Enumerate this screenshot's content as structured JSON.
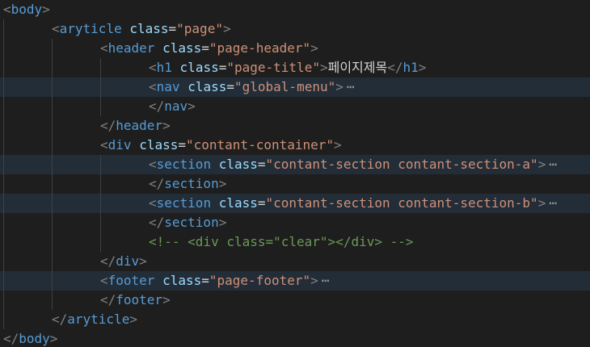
{
  "editor": {
    "lines": [
      {
        "indent": 0,
        "folded": false,
        "tokens": [
          {
            "t": "bracket",
            "v": "<"
          },
          {
            "t": "tag",
            "v": "body"
          },
          {
            "t": "bracket",
            "v": ">"
          }
        ]
      },
      {
        "indent": 1,
        "folded": false,
        "tokens": [
          {
            "t": "bracket",
            "v": "<"
          },
          {
            "t": "tag",
            "v": "aryticle"
          },
          {
            "t": "text",
            "v": " "
          },
          {
            "t": "attr",
            "v": "class"
          },
          {
            "t": "eq",
            "v": "="
          },
          {
            "t": "str",
            "v": "\"page\""
          },
          {
            "t": "bracket",
            "v": ">"
          }
        ]
      },
      {
        "indent": 2,
        "folded": false,
        "tokens": [
          {
            "t": "bracket",
            "v": "<"
          },
          {
            "t": "tag",
            "v": "header"
          },
          {
            "t": "text",
            "v": " "
          },
          {
            "t": "attr",
            "v": "class"
          },
          {
            "t": "eq",
            "v": "="
          },
          {
            "t": "str",
            "v": "\"page-header\""
          },
          {
            "t": "bracket",
            "v": ">"
          }
        ]
      },
      {
        "indent": 3,
        "folded": false,
        "tokens": [
          {
            "t": "bracket",
            "v": "<"
          },
          {
            "t": "tag",
            "v": "h1"
          },
          {
            "t": "text",
            "v": " "
          },
          {
            "t": "attr",
            "v": "class"
          },
          {
            "t": "eq",
            "v": "="
          },
          {
            "t": "str",
            "v": "\"page-title\""
          },
          {
            "t": "bracket",
            "v": ">"
          },
          {
            "t": "text",
            "v": "페이지제목"
          },
          {
            "t": "bracket",
            "v": "</"
          },
          {
            "t": "tag",
            "v": "h1"
          },
          {
            "t": "bracket",
            "v": ">"
          }
        ]
      },
      {
        "indent": 3,
        "folded": true,
        "tokens": [
          {
            "t": "bracket",
            "v": "<"
          },
          {
            "t": "tag",
            "v": "nav"
          },
          {
            "t": "text",
            "v": " "
          },
          {
            "t": "attr",
            "v": "class"
          },
          {
            "t": "eq",
            "v": "="
          },
          {
            "t": "str",
            "v": "\"global-menu\""
          },
          {
            "t": "bracket",
            "v": ">"
          },
          {
            "t": "ellipsis",
            "v": "⋯"
          }
        ]
      },
      {
        "indent": 3,
        "folded": false,
        "tokens": [
          {
            "t": "bracket",
            "v": "</"
          },
          {
            "t": "tag",
            "v": "nav"
          },
          {
            "t": "bracket",
            "v": ">"
          }
        ]
      },
      {
        "indent": 2,
        "folded": false,
        "tokens": [
          {
            "t": "bracket",
            "v": "</"
          },
          {
            "t": "tag",
            "v": "header"
          },
          {
            "t": "bracket",
            "v": ">"
          }
        ]
      },
      {
        "indent": 2,
        "folded": false,
        "tokens": [
          {
            "t": "bracket",
            "v": "<"
          },
          {
            "t": "tag",
            "v": "div"
          },
          {
            "t": "text",
            "v": " "
          },
          {
            "t": "attr",
            "v": "class"
          },
          {
            "t": "eq",
            "v": "="
          },
          {
            "t": "str",
            "v": "\"contant-container\""
          },
          {
            "t": "bracket",
            "v": ">"
          }
        ]
      },
      {
        "indent": 3,
        "folded": true,
        "tokens": [
          {
            "t": "bracket",
            "v": "<"
          },
          {
            "t": "tag",
            "v": "section"
          },
          {
            "t": "text",
            "v": " "
          },
          {
            "t": "attr",
            "v": "class"
          },
          {
            "t": "eq",
            "v": "="
          },
          {
            "t": "str",
            "v": "\"contant-section contant-section-a\""
          },
          {
            "t": "bracket",
            "v": ">"
          },
          {
            "t": "ellipsis",
            "v": "⋯"
          }
        ]
      },
      {
        "indent": 3,
        "folded": false,
        "tokens": [
          {
            "t": "bracket",
            "v": "</"
          },
          {
            "t": "tag",
            "v": "section"
          },
          {
            "t": "bracket",
            "v": ">"
          }
        ]
      },
      {
        "indent": 3,
        "folded": true,
        "tokens": [
          {
            "t": "bracket",
            "v": "<"
          },
          {
            "t": "tag",
            "v": "section"
          },
          {
            "t": "text",
            "v": " "
          },
          {
            "t": "attr",
            "v": "class"
          },
          {
            "t": "eq",
            "v": "="
          },
          {
            "t": "str",
            "v": "\"contant-section contant-section-b\""
          },
          {
            "t": "bracket",
            "v": ">"
          },
          {
            "t": "ellipsis",
            "v": "⋯"
          }
        ]
      },
      {
        "indent": 3,
        "folded": false,
        "tokens": [
          {
            "t": "bracket",
            "v": "</"
          },
          {
            "t": "tag",
            "v": "section"
          },
          {
            "t": "bracket",
            "v": ">"
          }
        ]
      },
      {
        "indent": 3,
        "folded": false,
        "tokens": [
          {
            "t": "comment",
            "v": "<!-- <div class=\"clear\"></div> -->"
          }
        ]
      },
      {
        "indent": 2,
        "folded": false,
        "tokens": [
          {
            "t": "bracket",
            "v": "</"
          },
          {
            "t": "tag",
            "v": "div"
          },
          {
            "t": "bracket",
            "v": ">"
          }
        ]
      },
      {
        "indent": 2,
        "folded": true,
        "tokens": [
          {
            "t": "bracket",
            "v": "<"
          },
          {
            "t": "tag",
            "v": "footer"
          },
          {
            "t": "text",
            "v": " "
          },
          {
            "t": "attr",
            "v": "class"
          },
          {
            "t": "eq",
            "v": "="
          },
          {
            "t": "str",
            "v": "\"page-footer\""
          },
          {
            "t": "bracket",
            "v": ">"
          },
          {
            "t": "ellipsis",
            "v": "⋯"
          }
        ]
      },
      {
        "indent": 2,
        "folded": false,
        "tokens": [
          {
            "t": "bracket",
            "v": "</"
          },
          {
            "t": "tag",
            "v": "footer"
          },
          {
            "t": "bracket",
            "v": ">"
          }
        ]
      },
      {
        "indent": 1,
        "folded": false,
        "tokens": [
          {
            "t": "bracket",
            "v": "</"
          },
          {
            "t": "tag",
            "v": "aryticle"
          },
          {
            "t": "bracket",
            "v": ">"
          }
        ]
      },
      {
        "indent": 0,
        "folded": false,
        "tokens": [
          {
            "t": "bracket",
            "v": "</"
          },
          {
            "t": "tag",
            "v": "body"
          },
          {
            "t": "bracket",
            "v": ">"
          }
        ]
      }
    ]
  },
  "colors": {
    "background": "#1e1e1e",
    "folded_line_highlight": "#232d38",
    "bracket": "#808080",
    "tag": "#569cd6",
    "attribute": "#9cdcfe",
    "string": "#ce9178",
    "text": "#d4d4d4",
    "comment": "#6a9955"
  }
}
